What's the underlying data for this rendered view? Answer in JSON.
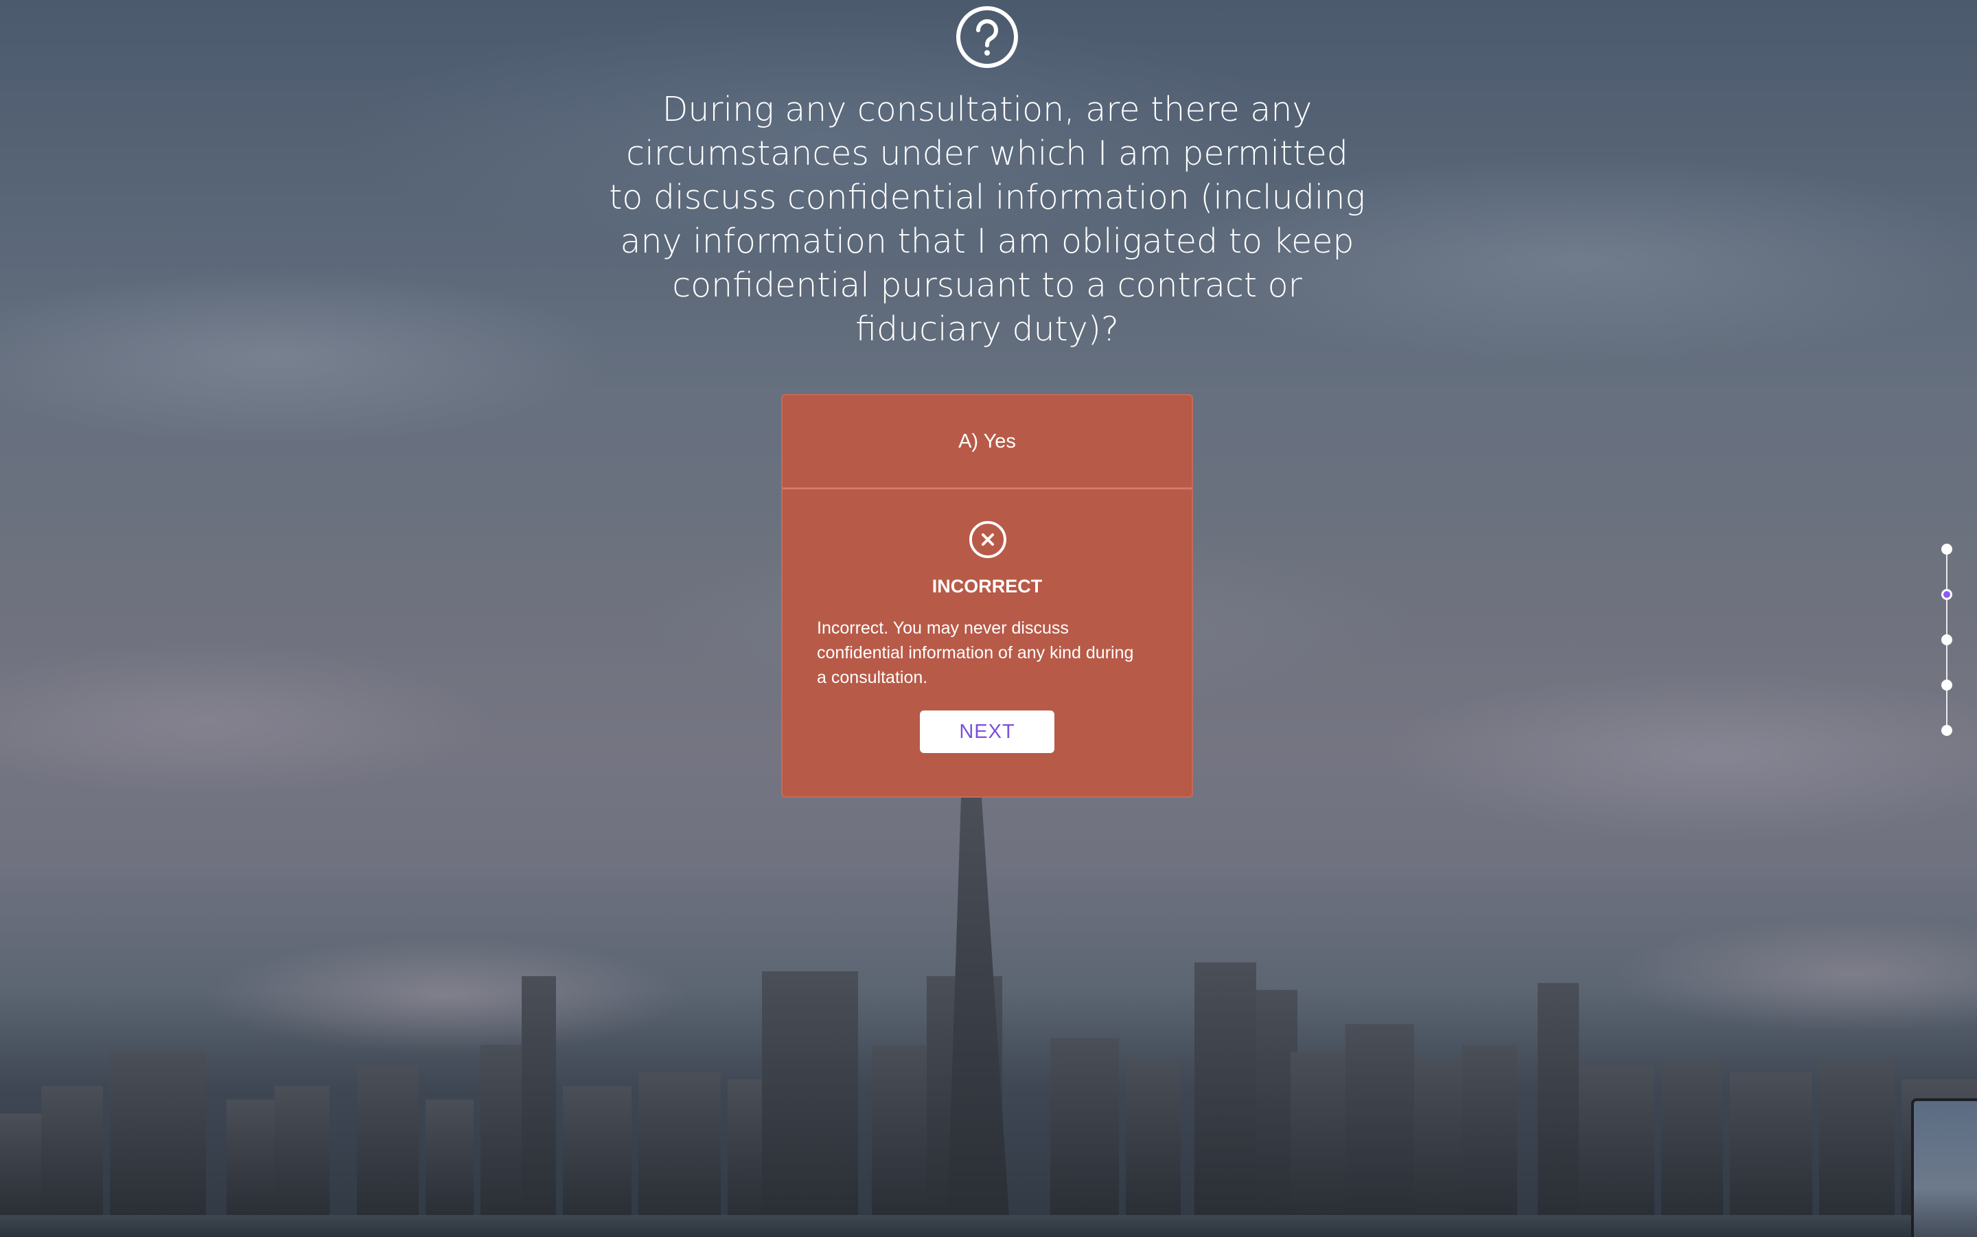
{
  "question": {
    "icon": "question-circle-icon",
    "text": "During any consultation, are there any circumstances under which I am permitted to discuss confidential information (including any information that I am obligated to keep confidential pursuant to a contract or fiduciary duty)?"
  },
  "answer": {
    "choice_label": "A) Yes",
    "result_icon": "x-circle-icon",
    "verdict": "INCORRECT",
    "explanation": "Incorrect. You may never discuss confidential information of any kind during a consultation.",
    "next_label": "NEXT",
    "card_color": "#b85a48",
    "next_text_color": "#7b4fe0"
  },
  "progress": {
    "total_steps": 5,
    "current_step": 2,
    "active_color": "#8b5cf6"
  }
}
